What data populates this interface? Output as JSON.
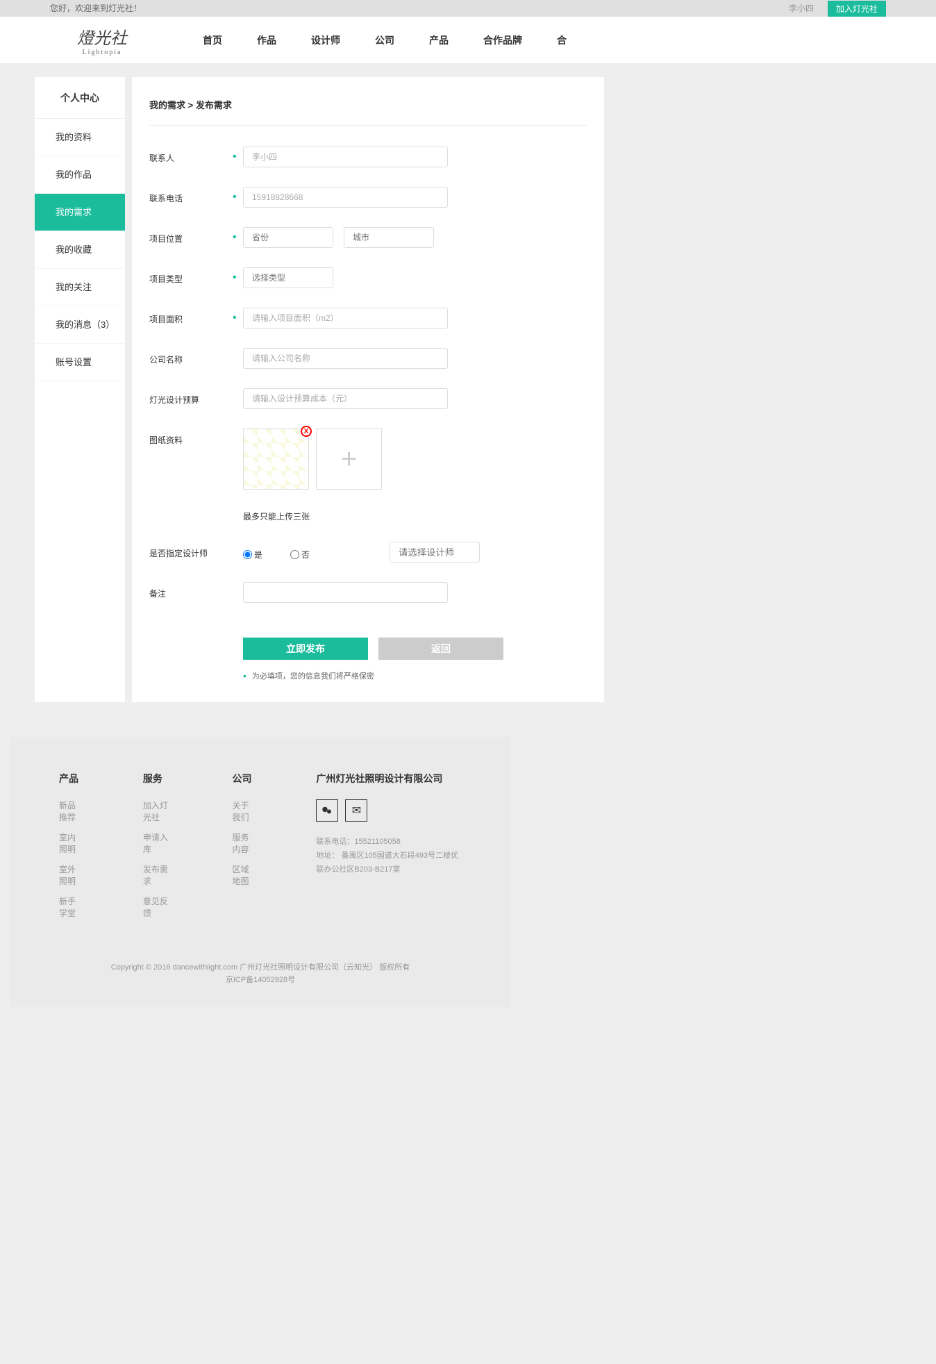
{
  "topbar": {
    "welcome": "您好，欢迎来到灯光社！",
    "user": "李小四",
    "join": "加入灯光社"
  },
  "logo": {
    "main": "燈光社",
    "sub": "Lightopia"
  },
  "nav": {
    "items": [
      "首页",
      "作品",
      "设计师",
      "公司",
      "产品",
      "合作品牌",
      "合"
    ]
  },
  "sidebar": {
    "header": "个人中心",
    "items": [
      {
        "label": "我的资料"
      },
      {
        "label": "我的作品"
      },
      {
        "label": "我的需求"
      },
      {
        "label": "我的收藏"
      },
      {
        "label": "我的关注"
      },
      {
        "label": "我的消息（3）"
      },
      {
        "label": "账号设置"
      }
    ]
  },
  "breadcrumb": {
    "parent": "我的需求",
    "sep": ">",
    "current": "发布需求"
  },
  "form": {
    "contact_label": "联系人",
    "contact_placeholder": "李小四",
    "phone_label": "联系电话",
    "phone_placeholder": "15918828668",
    "location_label": "项目位置",
    "province_placeholder": "省份",
    "city_placeholder": "城市",
    "type_label": "项目类型",
    "type_placeholder": "选择类型",
    "area_label": "项目面积",
    "area_placeholder": "请输入项目面积（m2）",
    "company_label": "公司名称",
    "company_placeholder": "请输入公司名称",
    "budget_label": "灯光设计预算",
    "budget_placeholder": "请输入设计预算成本（元）",
    "drawing_label": "图纸资料",
    "upload_hint": "最多只能上传三张",
    "designer_label": "是否指定设计师",
    "radio_yes": "是",
    "radio_no": "否",
    "designer_placeholder": "请选择设计师",
    "remark_label": "备注",
    "submit": "立即发布",
    "back": "返回",
    "note": "为必填项，您的信息我们将严格保密"
  },
  "footer": {
    "col1_title": "产品",
    "col1_links": [
      "新品推荐",
      "室内照明",
      "室外照明",
      "新手学堂"
    ],
    "col2_title": "服务",
    "col2_links": [
      "加入灯光社",
      "申请入库",
      "发布需求",
      "意见反馈"
    ],
    "col3_title": "公司",
    "col3_links": [
      "关于我们",
      "服务内容",
      "区域地图"
    ],
    "company_name": "广州灯光社照明设计有限公司",
    "phone": "联系电话：15521105058",
    "address": "地址：  番禺区105国道大石段493号二楼优联办公社区B203-B217室",
    "copyright1": "Copyright © 2016 dancewithlight.com 广州灯光社照明设计有限公司（云知光） 版权所有",
    "copyright2": "京ICP备14052928号"
  }
}
